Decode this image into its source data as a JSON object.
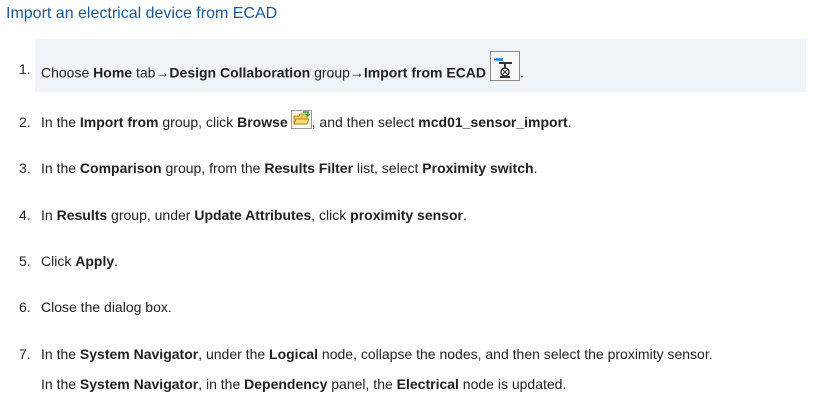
{
  "title": "Import an electrical device from ECAD",
  "icons": {
    "ecad": "import-from-ecad-icon",
    "browse": "open-folder-icon"
  },
  "steps": [
    {
      "num": "1.",
      "parts": [
        "Choose ",
        "Home",
        " tab",
        "→",
        "Design Collaboration",
        " group",
        "→",
        "Import from ECAD",
        "."
      ]
    },
    {
      "num": "2.",
      "parts": [
        "In the ",
        "Import from",
        " group, click ",
        "Browse",
        ", and then select ",
        "mcd01_sensor_import",
        "."
      ]
    },
    {
      "num": "3.",
      "parts": [
        "In the ",
        "Comparison",
        " group, from the ",
        "Results Filter",
        " list, select ",
        "Proximity switch",
        "."
      ]
    },
    {
      "num": "4.",
      "parts": [
        "In ",
        "Results",
        " group, under ",
        "Update Attributes",
        ", click ",
        "proximity sensor",
        "."
      ]
    },
    {
      "num": "5.",
      "parts": [
        "Click ",
        "Apply",
        "."
      ]
    },
    {
      "num": "6.",
      "parts": [
        "Close the dialog box."
      ]
    },
    {
      "num": "7.",
      "parts": [
        "In the ",
        "System Navigator",
        ", under the ",
        "Logical",
        " node, collapse the nodes, and then select the proximity sensor."
      ]
    }
  ],
  "result": {
    "parts": [
      "In the ",
      "System Navigator",
      ", in the ",
      "Dependency",
      " panel, the ",
      "Electrical",
      " node is updated."
    ]
  }
}
